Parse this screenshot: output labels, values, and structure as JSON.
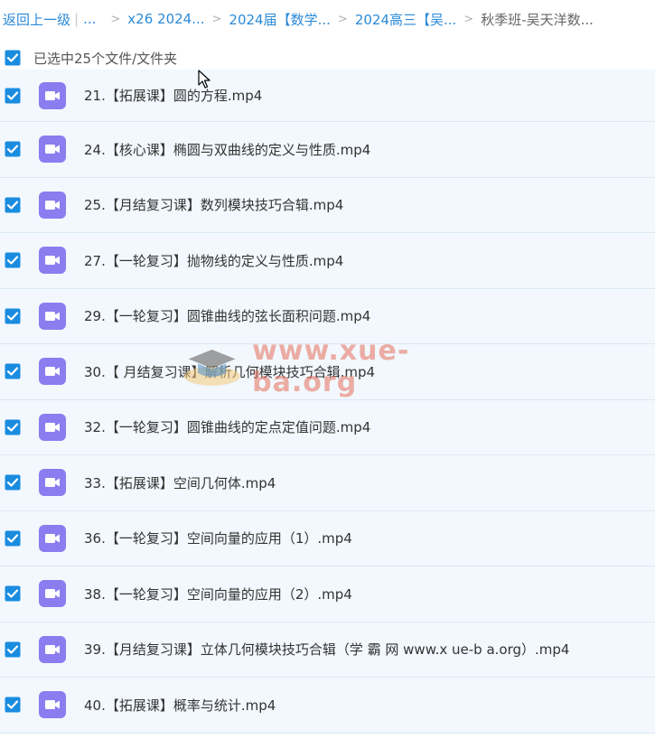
{
  "breadcrumb": {
    "back": "返回上一级",
    "ellipsis": "...",
    "items": [
      "x26 2024...",
      "2024届【数学...",
      "2024高三【吴..."
    ],
    "current": "秋季班-吴天洋数..."
  },
  "selection": {
    "label": "已选中25个文件/文件夹",
    "checked": true
  },
  "files": [
    {
      "name": "21.【拓展课】圆的方程.mp4",
      "icon": "video-file-icon"
    },
    {
      "name": "24.【核心课】椭圆与双曲线的定义与性质.mp4",
      "icon": "video-file-icon"
    },
    {
      "name": "25.【月结复习课】数列模块技巧合辑.mp4",
      "icon": "video-file-icon"
    },
    {
      "name": "27.【一轮复习】抛物线的定义与性质.mp4",
      "icon": "video-file-icon"
    },
    {
      "name": "29.【一轮复习】圆锥曲线的弦长面积问题.mp4",
      "icon": "video-file-icon"
    },
    {
      "name": "30.【 月结复习课】解析几何模块技巧合辑.mp4",
      "icon": "video-file-icon"
    },
    {
      "name": "32.【一轮复习】圆锥曲线的定点定值问题.mp4",
      "icon": "video-file-icon"
    },
    {
      "name": "33.【拓展课】空间几何体.mp4",
      "icon": "video-file-icon"
    },
    {
      "name": "36.【一轮复习】空间向量的应用（1）.mp4",
      "icon": "video-file-icon"
    },
    {
      "name": "38.【一轮复习】空间向量的应用（2）.mp4",
      "icon": "video-file-icon"
    },
    {
      "name": "39.【月结复习课】立体几何模块技巧合辑（学 霸 网 www.x ue-b a.org）.mp4",
      "icon": "video-file-icon"
    },
    {
      "name": "40.【拓展课】概率与统计.mp4",
      "icon": "video-file-icon"
    }
  ],
  "watermark": {
    "text": "www.xue-ba.org"
  },
  "colors": {
    "link": "#2b8ad8",
    "checkbox": "#1a8ce0",
    "row_bg": "#f2f8fe",
    "video_icon": "#8b7cf0"
  }
}
